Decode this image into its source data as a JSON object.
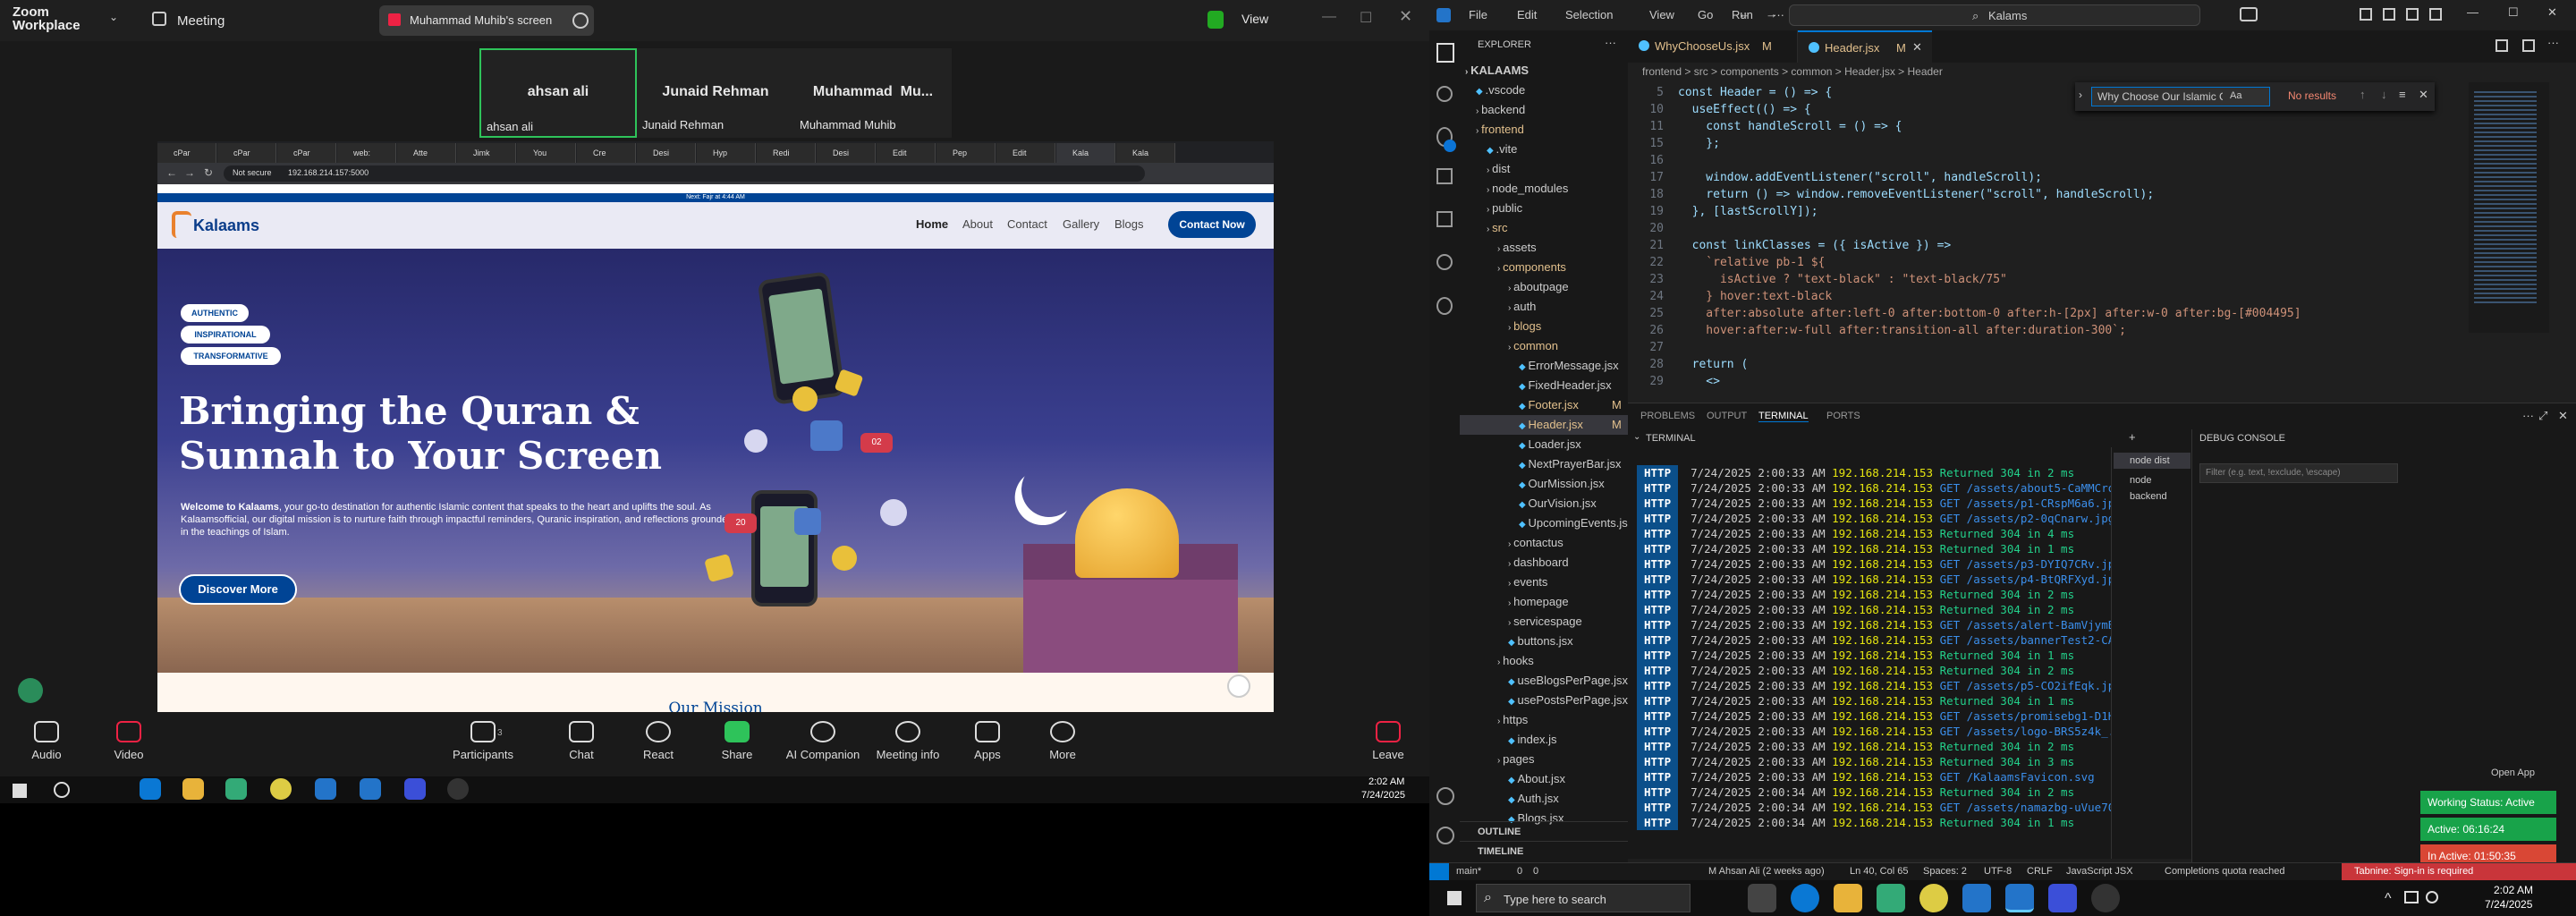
{
  "zoom": {
    "app_title": "Zoom Workplace",
    "meeting_label": "Meeting",
    "share_title": "Muhammad Muhib's screen",
    "view_label": "View",
    "participants": [
      {
        "big": "ahsan ali",
        "small": "ahsan ali"
      },
      {
        "big": "Junaid Rehman",
        "small": "Junaid Rehman"
      },
      {
        "big": "Muhammad  Mu...",
        "small": "Muhammad Muhib"
      }
    ],
    "toolbar": [
      "Audio",
      "Video",
      "Participants",
      "Chat",
      "React",
      "Share",
      "AI Companion",
      "Meeting info",
      "Apps",
      "More",
      "Leave"
    ],
    "participants_count": "3"
  },
  "browser": {
    "tabs": [
      "cPar",
      "cPar",
      "cPar",
      "web:",
      "Atte",
      "Jimk",
      "You",
      "Cre",
      "Desi",
      "Hyp",
      "Redi",
      "Desi",
      "Edit",
      "Pep",
      "Edit",
      "Kala",
      "Kala"
    ],
    "not_secure": "Not secure",
    "url": "192.168.214.157:5000"
  },
  "site": {
    "prayer_bar": "Next: Fajr at 4:44 AM",
    "logo": "Kalaams",
    "nav": [
      "Home",
      "About",
      "Contact",
      "Gallery",
      "Blogs"
    ],
    "cta": "Contact Now",
    "tags": [
      "AUTHENTIC",
      "INSPIRATIONAL",
      "TRANSFORMATIVE"
    ],
    "headline1": "Bringing the Quran &",
    "headline2": "Sunnah to Your Screen",
    "body_lead": "Welcome to Kalaams",
    "body": ", your go-to destination for authentic Islamic content that speaks to the heart and uplifts the soul. As Kalaamsofficial, our digital mission is to nurture faith through impactful reminders, Quranic inspiration, and reflections grounded in the teachings of Islam.",
    "discover": "Discover More",
    "mission": "Our Mission",
    "bubbles": [
      "20",
      "02"
    ]
  },
  "windows_left": {
    "time": "2:02 AM",
    "date": "7/24/2025"
  },
  "vscode": {
    "menu": [
      "File",
      "Edit",
      "Selection",
      "View",
      "Go",
      "Run",
      "···"
    ],
    "search": "Kalams",
    "tabs": [
      {
        "label": "WhyChooseUs.jsx",
        "mod": "M"
      },
      {
        "label": "Header.jsx",
        "mod": "M"
      }
    ],
    "breadcrumb": "frontend > src > components > common > Header.jsx > Header",
    "find": {
      "value": "Why Choose Our Islamic Co",
      "result": "No results",
      "opt": "Aa"
    },
    "explorer_title": "EXPLORER",
    "tree": [
      {
        "t": "KALAAMS",
        "d": 0,
        "k": "root"
      },
      {
        "t": ".vscode",
        "d": 1
      },
      {
        "t": "backend",
        "d": 1
      },
      {
        "t": "frontend",
        "d": 1,
        "c": "mod"
      },
      {
        "t": ".vite",
        "d": 2
      },
      {
        "t": "dist",
        "d": 2
      },
      {
        "t": "node_modules",
        "d": 2
      },
      {
        "t": "public",
        "d": 2
      },
      {
        "t": "src",
        "d": 2,
        "c": "mod"
      },
      {
        "t": "assets",
        "d": 3
      },
      {
        "t": "components",
        "d": 3,
        "c": "mod"
      },
      {
        "t": "aboutpage",
        "d": 4
      },
      {
        "t": "auth",
        "d": 4
      },
      {
        "t": "blogs",
        "d": 4,
        "c": "mod"
      },
      {
        "t": "common",
        "d": 4,
        "c": "mod"
      },
      {
        "t": "ErrorMessage.jsx",
        "d": 5
      },
      {
        "t": "FixedHeader.jsx",
        "d": 5
      },
      {
        "t": "Footer.jsx",
        "d": 5,
        "c": "mod",
        "m": "M"
      },
      {
        "t": "Header.jsx",
        "d": 5,
        "c": "mod",
        "m": "M",
        "sel": true
      },
      {
        "t": "Loader.jsx",
        "d": 5
      },
      {
        "t": "NextPrayerBar.jsx",
        "d": 5
      },
      {
        "t": "OurMission.jsx",
        "d": 5
      },
      {
        "t": "OurVision.jsx",
        "d": 5
      },
      {
        "t": "UpcomingEvents.jsx",
        "d": 5
      },
      {
        "t": "contactus",
        "d": 4
      },
      {
        "t": "dashboard",
        "d": 4
      },
      {
        "t": "events",
        "d": 4
      },
      {
        "t": "homepage",
        "d": 4
      },
      {
        "t": "servicespage",
        "d": 4
      },
      {
        "t": "buttons.jsx",
        "d": 4
      },
      {
        "t": "hooks",
        "d": 3
      },
      {
        "t": "useBlogsPerPage.jsx",
        "d": 4
      },
      {
        "t": "usePostsPerPage.jsx",
        "d": 4
      },
      {
        "t": "https",
        "d": 3
      },
      {
        "t": "index.js",
        "d": 4
      },
      {
        "t": "pages",
        "d": 3
      },
      {
        "t": "About.jsx",
        "d": 4
      },
      {
        "t": "Auth.jsx",
        "d": 4
      },
      {
        "t": "Blogs.jsx",
        "d": 4
      }
    ],
    "outline": "OUTLINE",
    "timeline": "TIMELINE",
    "code": [
      {
        "n": "5",
        "s": "const Header = () => {"
      },
      {
        "n": "10",
        "s": "  useEffect(() => {"
      },
      {
        "n": "11",
        "s": "    const handleScroll = () => {"
      },
      {
        "n": "15",
        "s": "    };"
      },
      {
        "n": "16",
        "s": ""
      },
      {
        "n": "17",
        "s": "    window.addEventListener(\"scroll\", handleScroll);"
      },
      {
        "n": "18",
        "s": "    return () => window.removeEventListener(\"scroll\", handleScroll);"
      },
      {
        "n": "19",
        "s": "  }, [lastScrollY]);"
      },
      {
        "n": "20",
        "s": ""
      },
      {
        "n": "21",
        "s": "  const linkClasses = ({ isActive }) =>"
      },
      {
        "n": "22",
        "s": "    `relative pb-1 ${"
      },
      {
        "n": "23",
        "s": "      isActive ? \"text-black\" : \"text-black/75\""
      },
      {
        "n": "24",
        "s": "    } hover:text-black"
      },
      {
        "n": "25",
        "s": "    after:absolute after:left-0 after:bottom-0 after:h-[2px] after:w-0 after:bg-[#004495]"
      },
      {
        "n": "26",
        "s": "    hover:after:w-full after:transition-all after:duration-300`;"
      },
      {
        "n": "27",
        "s": ""
      },
      {
        "n": "28",
        "s": "  return ("
      },
      {
        "n": "29",
        "s": "    <>"
      }
    ],
    "panel_tabs": [
      "PROBLEMS",
      "OUTPUT",
      "TERMINAL",
      "PORTS"
    ],
    "terminal_label": "TERMINAL",
    "terminals": [
      "node  dist",
      "node  backend"
    ],
    "log": [
      {
        "tag": "HTTP",
        "d": "7/24/2025 2:00:33 AM",
        "ip": "192.168.214.153",
        "msg": "Returned 304 in 2 ms"
      },
      {
        "tag": "HTTP",
        "d": "7/24/2025 2:00:33 AM",
        "ip": "192.168.214.153",
        "msg": "GET /assets/about5-CaMMCrqS.jpg"
      },
      {
        "tag": "HTTP",
        "d": "7/24/2025 2:00:33 AM",
        "ip": "192.168.214.153",
        "msg": "GET /assets/p1-CRspM6a6.jpg"
      },
      {
        "tag": "HTTP",
        "d": "7/24/2025 2:00:33 AM",
        "ip": "192.168.214.153",
        "msg": "GET /assets/p2-0qCnarw.jpg"
      },
      {
        "tag": "HTTP",
        "d": "7/24/2025 2:00:33 AM",
        "ip": "192.168.214.153",
        "msg": "Returned 304 in 4 ms"
      },
      {
        "tag": "HTTP",
        "d": "7/24/2025 2:00:33 AM",
        "ip": "192.168.214.153",
        "msg": "Returned 304 in 1 ms"
      },
      {
        "tag": "HTTP",
        "d": "7/24/2025 2:00:33 AM",
        "ip": "192.168.214.153",
        "msg": "GET /assets/p3-DYIQ7CRv.jpg"
      },
      {
        "tag": "HTTP",
        "d": "7/24/2025 2:00:33 AM",
        "ip": "192.168.214.153",
        "msg": "GET /assets/p4-BtQRFXyd.jpg"
      },
      {
        "tag": "HTTP",
        "d": "7/24/2025 2:00:33 AM",
        "ip": "192.168.214.153",
        "msg": "Returned 304 in 2 ms"
      },
      {
        "tag": "HTTP",
        "d": "7/24/2025 2:00:33 AM",
        "ip": "192.168.214.153",
        "msg": "Returned 304 in 2 ms"
      },
      {
        "tag": "HTTP",
        "d": "7/24/2025 2:00:33 AM",
        "ip": "192.168.214.153",
        "msg": "GET /assets/alert-BamVjymB.png"
      },
      {
        "tag": "HTTP",
        "d": "7/24/2025 2:00:33 AM",
        "ip": "192.168.214.153",
        "msg": "GET /assets/bannerTest2-CAAgCic2.jpg"
      },
      {
        "tag": "HTTP",
        "d": "7/24/2025 2:00:33 AM",
        "ip": "192.168.214.153",
        "msg": "Returned 304 in 1 ms"
      },
      {
        "tag": "HTTP",
        "d": "7/24/2025 2:00:33 AM",
        "ip": "192.168.214.153",
        "msg": "Returned 304 in 2 ms"
      },
      {
        "tag": "HTTP",
        "d": "7/24/2025 2:00:33 AM",
        "ip": "192.168.214.153",
        "msg": "GET /assets/p5-CO2ifEqk.jpg"
      },
      {
        "tag": "HTTP",
        "d": "7/24/2025 2:00:33 AM",
        "ip": "192.168.214.153",
        "msg": "Returned 304 in 1 ms"
      },
      {
        "tag": "HTTP",
        "d": "7/24/2025 2:00:33 AM",
        "ip": "192.168.214.153",
        "msg": "GET /assets/promisebg1-D1HK4Msv.png"
      },
      {
        "tag": "HTTP",
        "d": "7/24/2025 2:00:33 AM",
        "ip": "192.168.214.153",
        "msg": "GET /assets/logo-BRS5z4k_.png"
      },
      {
        "tag": "HTTP",
        "d": "7/24/2025 2:00:33 AM",
        "ip": "192.168.214.153",
        "msg": "Returned 304 in 2 ms"
      },
      {
        "tag": "HTTP",
        "d": "7/24/2025 2:00:33 AM",
        "ip": "192.168.214.153",
        "msg": "Returned 304 in 3 ms"
      },
      {
        "tag": "HTTP",
        "d": "7/24/2025 2:00:33 AM",
        "ip": "192.168.214.153",
        "msg": "GET /KalaamsFavicon.svg"
      },
      {
        "tag": "HTTP",
        "d": "7/24/2025 2:00:34 AM",
        "ip": "192.168.214.153",
        "msg": "Returned 304 in 2 ms"
      },
      {
        "tag": "HTTP",
        "d": "7/24/2025 2:00:34 AM",
        "ip": "192.168.214.153",
        "msg": "GET /assets/namazbg-uVue70cU.png"
      },
      {
        "tag": "HTTP",
        "d": "7/24/2025 2:00:34 AM",
        "ip": "192.168.214.153",
        "msg": "Returned 304 in 1 ms"
      }
    ],
    "debug_title": "DEBUG CONSOLE",
    "debug_filter": "Filter (e.g. text, !exclude, \\escape)",
    "open_app": "Open App",
    "working": "Working Status: Active",
    "active": "Active: 06:16:24",
    "inactive": "In Active: 01:50:35",
    "status": {
      "branch": "main*",
      "git": "M Ahsan Ali (2 weeks ago)",
      "errors": "0",
      "warnings": "0",
      "pos": "Ln 40, Col 65",
      "spaces": "Spaces: 2",
      "enc": "UTF-8",
      "eol": "CRLF",
      "lang": "JavaScript JSX",
      "quota": "Completions quota reached",
      "tabnine": "Tabnine: Sign-in is required"
    }
  },
  "taskbar": {
    "search": "Type here to search",
    "time": "2:02 AM",
    "date": "7/24/2025"
  }
}
